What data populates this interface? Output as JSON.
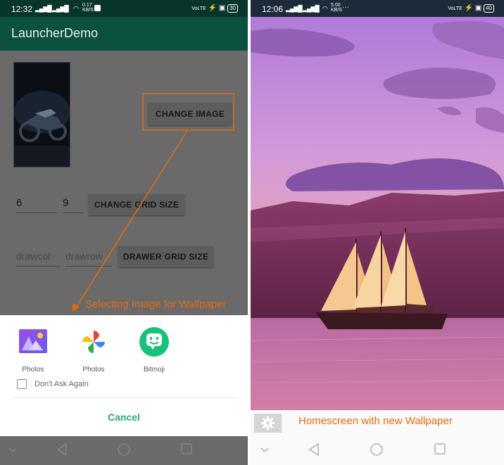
{
  "left_screen": {
    "status": {
      "time": "12:32",
      "net_speed": "0.17",
      "net_unit": "KB/S",
      "net_type": "VoLTE",
      "battery": "30"
    },
    "app_title": "LauncherDemo",
    "change_image_label": "CHANGE IMAGE",
    "grid": {
      "columns": "6",
      "rows": "9",
      "button_label": "CHANGE GRID SIZE"
    },
    "drawer": {
      "col_placeholder": "drawcol",
      "row_placeholder": "drawrow",
      "button_label": "DRAWER GRID SIZE"
    },
    "chooser": {
      "apps": [
        {
          "label": "Photos",
          "icon": "photos-wallpaper-icon"
        },
        {
          "label": "Photos",
          "icon": "google-photos-icon"
        },
        {
          "label": "Bitmoji",
          "icon": "bitmoji-icon"
        }
      ],
      "dont_ask_label": "Don't Ask Again",
      "cancel_label": "Cancel"
    }
  },
  "right_screen": {
    "status": {
      "time": "12:06",
      "net_speed": "5.00",
      "net_unit": "KB/S",
      "net_type": "VoLTE",
      "battery": "40"
    },
    "dock_icon": "settings-icon"
  },
  "annotations": {
    "left": "Selecting Image for Wallpaper",
    "right": "Homescreen with new Wallpaper"
  },
  "colors": {
    "status_bar": "#08352a",
    "app_bar": "#0c5040",
    "cancel": "#26a87a",
    "annotation": "#e46a10"
  }
}
